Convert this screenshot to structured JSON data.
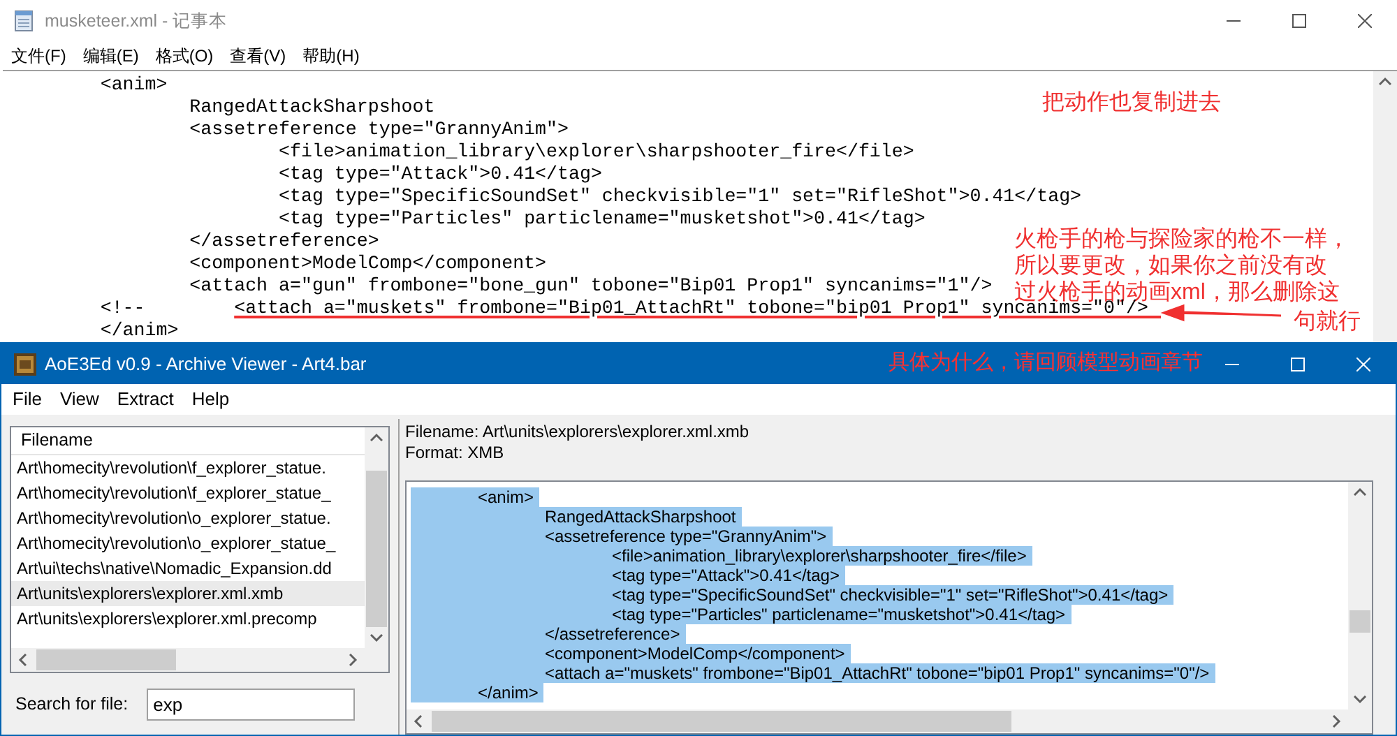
{
  "notepad": {
    "title": "musketeer.xml - 记事本",
    "menu": [
      "文件(F)",
      "编辑(E)",
      "格式(O)",
      "查看(V)",
      "帮助(H)"
    ],
    "lines": [
      {
        "text": "\t<anim>",
        "struck": false
      },
      {
        "text": "\t\tRangedAttackSharpshoot",
        "struck": false
      },
      {
        "text": "\t\t<assetreference type=\"GrannyAnim\">",
        "struck": false
      },
      {
        "text": "\t\t\t<file>animation_library\\explorer\\sharpshooter_fire</file>",
        "struck": false
      },
      {
        "text": "\t\t\t<tag type=\"Attack\">0.41</tag>",
        "struck": false
      },
      {
        "text": "\t\t\t<tag type=\"SpecificSoundSet\" checkvisible=\"1\" set=\"RifleShot\">0.41</tag>",
        "struck": false
      },
      {
        "text": "\t\t\t<tag type=\"Particles\" particlename=\"musketshot\">0.41</tag>",
        "struck": false
      },
      {
        "text": "\t\t</assetreference>",
        "struck": false
      },
      {
        "text": "\t\t<component>ModelComp</component>",
        "struck": false
      },
      {
        "text": "\t\t<attach a=\"gun\" frombone=\"bone_gun\" tobone=\"Bip01 Prop1\" syncanims=\"1\"/>",
        "struck": false
      },
      {
        "parts": [
          {
            "text": "\t<!--",
            "struck": false
          },
          {
            "text": "\t<attach a=\"muskets\" frombone=\"Bip01_AttachRt\" tobone=\"bip01 Prop1\" syncanims=\"0\"/>",
            "struck": true
          }
        ]
      },
      {
        "text": "\t</anim>",
        "struck": false
      }
    ]
  },
  "archive_viewer": {
    "title": "AoE3Ed v0.9 - Archive Viewer - Art4.bar",
    "menu": [
      "File",
      "View",
      "Extract",
      "Help"
    ],
    "file_list": {
      "column": "Filename",
      "rows": [
        {
          "name": "Art\\homecity\\revolution\\f_explorer_statue.",
          "selected": false
        },
        {
          "name": "Art\\homecity\\revolution\\f_explorer_statue_",
          "selected": false
        },
        {
          "name": "Art\\homecity\\revolution\\o_explorer_statue.",
          "selected": false
        },
        {
          "name": "Art\\homecity\\revolution\\o_explorer_statue_",
          "selected": false
        },
        {
          "name": "Art\\ui\\techs\\native\\Nomadic_Expansion.dd",
          "selected": false
        },
        {
          "name": "Art\\units\\explorers\\explorer.xml.xmb",
          "selected": true
        },
        {
          "name": "Art\\units\\explorers\\explorer.xml.precomp",
          "selected": false
        }
      ]
    },
    "search": {
      "label": "Search for file:",
      "value": "exp"
    },
    "info": [
      "Filename: Art\\units\\explorers\\explorer.xml.xmb",
      "Format: XMB"
    ],
    "viewer": {
      "selected": true,
      "lines": [
        "\t<anim>",
        "\t\tRangedAttackSharpshoot",
        "\t\t<assetreference type=\"GrannyAnim\">",
        "\t\t\t<file>animation_library\\explorer\\sharpshooter_fire</file>",
        "\t\t\t<tag type=\"Attack\">0.41</tag>",
        "\t\t\t<tag type=\"SpecificSoundSet\" checkvisible=\"1\" set=\"RifleShot\">0.41</tag>",
        "\t\t\t<tag type=\"Particles\" particlename=\"musketshot\">0.41</tag>",
        "\t\t</assetreference>",
        "\t\t<component>ModelComp</component>",
        "\t\t<attach a=\"muskets\" frombone=\"Bip01_AttachRt\" tobone=\"bip01 Prop1\" syncanims=\"0\"/>",
        "\t</anim>"
      ]
    }
  },
  "annotations": [
    {
      "kind": "top",
      "text": "把动作也复制进去"
    },
    {
      "kind": "side",
      "lines": [
        "火枪手的枪与探险家的枪不一样，",
        "所以要更改，如果你之前没有改",
        "过火枪手的动画xml，那么删除这"
      ]
    },
    {
      "kind": "tail",
      "text": "句就行"
    },
    {
      "kind": "title",
      "text": "具体为什么，请回顾模型动画章节"
    }
  ]
}
